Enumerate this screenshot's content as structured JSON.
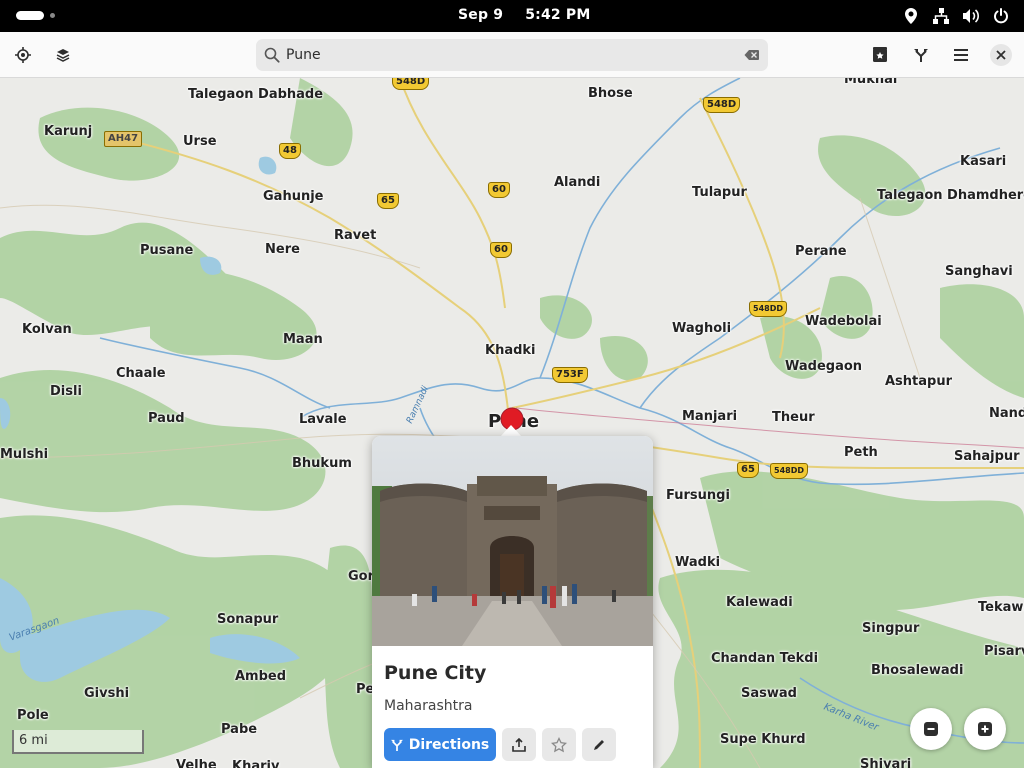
{
  "topbar": {
    "date": "Sep 9",
    "time": "5:42 PM",
    "tray_icons": [
      "location-icon",
      "network-icon",
      "volume-icon",
      "power-icon"
    ]
  },
  "header": {
    "search_value": "Pune",
    "buttons_left": [
      "locate-icon",
      "layers-icon"
    ],
    "buttons_right": [
      "favorites-icon",
      "route-icon",
      "menu-icon",
      "close-icon"
    ]
  },
  "map": {
    "places": [
      {
        "id": "mukhai",
        "label": "Mukhai"
      },
      {
        "id": "talegaon-dabhade",
        "label": "Talegaon Dabhade"
      },
      {
        "id": "bhose",
        "label": "Bhose"
      },
      {
        "id": "karunj",
        "label": "Karunj"
      },
      {
        "id": "urse",
        "label": "Urse"
      },
      {
        "id": "kasari",
        "label": "Kasari"
      },
      {
        "id": "alandi",
        "label": "Alandi"
      },
      {
        "id": "tulapur",
        "label": "Tulapur"
      },
      {
        "id": "talegaon-dhamdhere",
        "label": "Talegaon Dhamdhere"
      },
      {
        "id": "gahunje",
        "label": "Gahunje"
      },
      {
        "id": "ravet",
        "label": "Ravet"
      },
      {
        "id": "pusane",
        "label": "Pusane"
      },
      {
        "id": "nere",
        "label": "Nere"
      },
      {
        "id": "perane",
        "label": "Perane"
      },
      {
        "id": "sanghavi",
        "label": "Sanghavi"
      },
      {
        "id": "wagholi",
        "label": "Wagholi"
      },
      {
        "id": "wadebolai",
        "label": "Wadebolai"
      },
      {
        "id": "kolvan",
        "label": "Kolvan"
      },
      {
        "id": "maan",
        "label": "Maan"
      },
      {
        "id": "khadki",
        "label": "Khadki"
      },
      {
        "id": "chaale",
        "label": "Chaale"
      },
      {
        "id": "wadegaon",
        "label": "Wadegaon"
      },
      {
        "id": "ashtapur",
        "label": "Ashtapur"
      },
      {
        "id": "disli",
        "label": "Disli"
      },
      {
        "id": "paud",
        "label": "Paud"
      },
      {
        "id": "lavale",
        "label": "Lavale"
      },
      {
        "id": "pune",
        "label": "Pune"
      },
      {
        "id": "manjari",
        "label": "Manjari"
      },
      {
        "id": "theur",
        "label": "Theur"
      },
      {
        "id": "nand",
        "label": "Nand"
      },
      {
        "id": "mulshi",
        "label": "Mulshi"
      },
      {
        "id": "bhukum",
        "label": "Bhukum"
      },
      {
        "id": "peth",
        "label": "Peth"
      },
      {
        "id": "sahajpur",
        "label": "Sahajpur"
      },
      {
        "id": "fursungi",
        "label": "Fursungi"
      },
      {
        "id": "wadki",
        "label": "Wadki"
      },
      {
        "id": "gor",
        "label": "Gor"
      },
      {
        "id": "kalewadi",
        "label": "Kalewadi"
      },
      {
        "id": "tekawa",
        "label": "Tekawa"
      },
      {
        "id": "sonapur",
        "label": "Sonapur"
      },
      {
        "id": "singpur",
        "label": "Singpur"
      },
      {
        "id": "pisarv",
        "label": "Pisarv"
      },
      {
        "id": "chandan-tekdi",
        "label": "Chandan Tekdi"
      },
      {
        "id": "ambed",
        "label": "Ambed"
      },
      {
        "id": "bhosalewadi",
        "label": "Bhosalewadi"
      },
      {
        "id": "givshi",
        "label": "Givshi"
      },
      {
        "id": "pe",
        "label": "Pe"
      },
      {
        "id": "saswad",
        "label": "Saswad"
      },
      {
        "id": "pole",
        "label": "Pole"
      },
      {
        "id": "pabe",
        "label": "Pabe"
      },
      {
        "id": "supe-khurd",
        "label": "Supe Khurd"
      },
      {
        "id": "shivari",
        "label": "Shivari"
      },
      {
        "id": "velhe",
        "label": "Velhe"
      },
      {
        "id": "khariv",
        "label": "Khariv"
      }
    ],
    "shields": [
      "548D",
      "548D",
      "AH47",
      "48",
      "65",
      "60",
      "60",
      "548DD",
      "753F",
      "65",
      "548DD"
    ],
    "rivers": [
      "Varasgaon",
      "Karha River",
      "Ramnadi"
    ],
    "scale_label": "6 mi"
  },
  "popover": {
    "title": "Pune City",
    "subtitle": "Maharashtra",
    "directions_label": "Directions",
    "actions": [
      "share-icon",
      "favorite-star-icon",
      "edit-icon"
    ]
  }
}
